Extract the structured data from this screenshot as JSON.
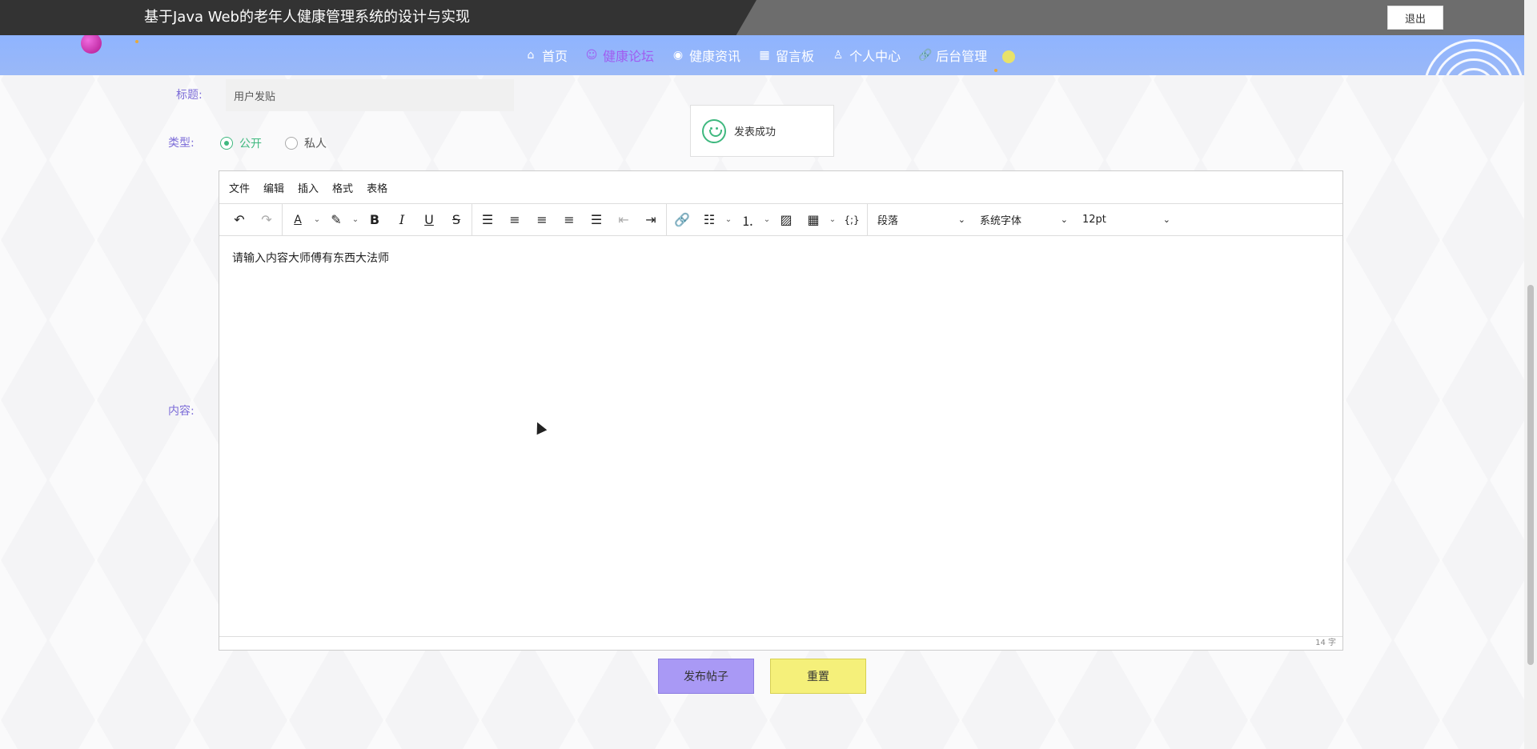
{
  "header": {
    "app_title": "基于Java Web的老年人健康管理系统的设计与实现",
    "logout_label": "退出"
  },
  "nav": {
    "items": [
      {
        "label": "首页",
        "icon": "home-icon",
        "glyph": "⌂",
        "active": false
      },
      {
        "label": "健康论坛",
        "icon": "smile-icon",
        "glyph": "☺",
        "active": true
      },
      {
        "label": "健康资讯",
        "icon": "globe-icon",
        "glyph": "◉",
        "active": false
      },
      {
        "label": "留言板",
        "icon": "gift-icon",
        "glyph": "▦",
        "active": false
      },
      {
        "label": "个人中心",
        "icon": "user-icon",
        "glyph": "♙",
        "active": false
      },
      {
        "label": "后台管理",
        "icon": "link-icon",
        "glyph": "🔗",
        "active": false
      }
    ]
  },
  "form": {
    "title_label": "标题:",
    "title_value": "用户发贴",
    "type_label": "类型:",
    "type_options": [
      "公开",
      "私人"
    ],
    "type_selected": "公开",
    "content_label": "内容:"
  },
  "toast": {
    "message": "发表成功",
    "icon": "smile-icon"
  },
  "editor": {
    "menu": [
      "文件",
      "编辑",
      "插入",
      "格式",
      "表格"
    ],
    "format_select": "段落",
    "font_select": "系统字体",
    "size_select": "12pt",
    "content": "请输入内容大师傅有东西大法师",
    "word_count": "14 字"
  },
  "actions": {
    "publish_label": "发布帖子",
    "reset_label": "重置"
  },
  "colors": {
    "accent": "#a05cf0",
    "label": "#7c6cd8",
    "success": "#3fb87f",
    "publish_button": "#a999f5",
    "reset_button": "#f5f07a"
  }
}
